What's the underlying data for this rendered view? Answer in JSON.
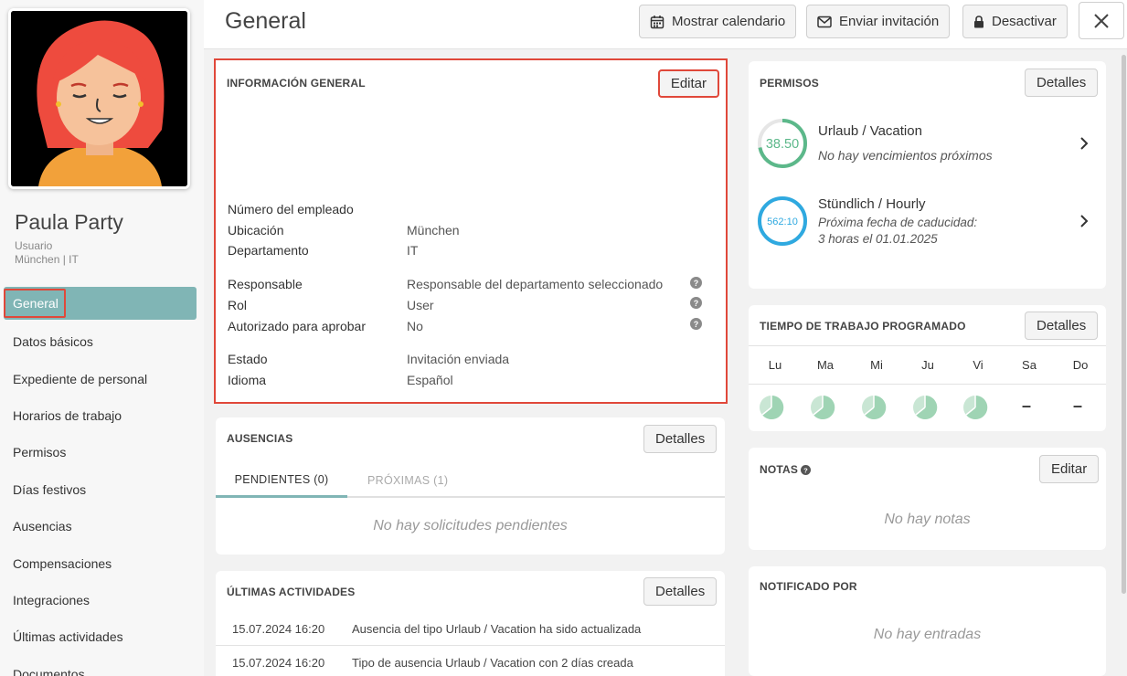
{
  "user": {
    "name": "Paula Party",
    "role": "Usuario",
    "location": "München | IT"
  },
  "sidebar": {
    "items": [
      {
        "label": "General"
      },
      {
        "label": "Datos básicos"
      },
      {
        "label": "Expediente de personal"
      },
      {
        "label": "Horarios de trabajo"
      },
      {
        "label": "Permisos"
      },
      {
        "label": "Días festivos"
      },
      {
        "label": "Ausencias"
      },
      {
        "label": "Compensaciones"
      },
      {
        "label": "Integraciones"
      },
      {
        "label": "Últimas actividades"
      },
      {
        "label": "Documentos"
      }
    ]
  },
  "header": {
    "title": "General",
    "calendar_label": "Mostrar calendario",
    "invite_label": "Enviar invitación",
    "deactivate_label": "Desactivar"
  },
  "info": {
    "title": "INFORMACIÓN GENERAL",
    "edit_label": "Editar",
    "rows": [
      {
        "label": "Número del empleado",
        "value": ""
      },
      {
        "label": "Ubicación",
        "value": "München"
      },
      {
        "label": "Departamento",
        "value": "IT"
      },
      {
        "label": "Responsable",
        "value": "Responsable del departamento seleccionado"
      },
      {
        "label": "Rol",
        "value": "User"
      },
      {
        "label": "Autorizado para aprobar",
        "value": "No"
      },
      {
        "label": "Estado",
        "value": "Invitación enviada"
      },
      {
        "label": "Idioma",
        "value": "Español"
      }
    ]
  },
  "absences": {
    "title": "AUSENCIAS",
    "details_label": "Detalles",
    "tab_pending": "PENDIENTES  (0)",
    "tab_upcoming": "PRÓXIMAS  (1)",
    "empty": "No hay solicitudes pendientes"
  },
  "activities": {
    "title": "ÚLTIMAS ACTIVIDADES",
    "details_label": "Detalles",
    "rows": [
      {
        "date": "15.07.2024 16:20",
        "text": "Ausencia del tipo Urlaub / Vacation ha sido actualizada"
      },
      {
        "date": "15.07.2024 16:20",
        "text": "Tipo de ausencia Urlaub / Vacation con 2 días creada"
      }
    ]
  },
  "permissions": {
    "title": "PERMISOS",
    "details_label": "Detalles",
    "items": [
      {
        "value": "38.50",
        "name": "Urlaub / Vacation",
        "sub1": "No hay vencimientos próximos",
        "sub2": "",
        "color": "#5cb88a",
        "fill": 0.72
      },
      {
        "value": "562:10",
        "name": "Stündlich / Hourly",
        "sub1": "Próxima fecha de caducidad:",
        "sub2": "3 horas el 01.01.2025",
        "color": "#2fa9e0",
        "fill": 1.0
      }
    ]
  },
  "schedule": {
    "title": "TIEMPO DE TRABAJO PROGRAMADO",
    "details_label": "Detalles",
    "days": [
      "Lu",
      "Ma",
      "Mi",
      "Ju",
      "Vi",
      "Sa",
      "Do"
    ],
    "dash": "–"
  },
  "notes": {
    "title": "NOTAS",
    "edit_label": "Editar",
    "empty": "No hay notas"
  },
  "notified": {
    "title": "NOTIFICADO POR",
    "empty": "No hay entradas"
  },
  "colors": {
    "accent": "#80b5b5",
    "highlight": "#e0483a",
    "pie": "#9fd4b4"
  }
}
